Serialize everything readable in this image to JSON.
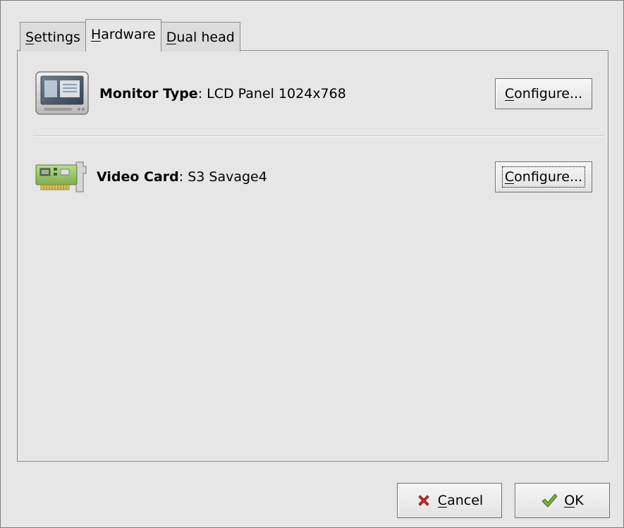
{
  "tabs": [
    {
      "label_mnemonic": "S",
      "label_rest": "ettings",
      "active": false
    },
    {
      "label_mnemonic": "H",
      "label_rest": "ardware",
      "active": true
    },
    {
      "label_mnemonic": "D",
      "label_rest": "ual head",
      "active": false
    }
  ],
  "hardware": {
    "monitor": {
      "icon": "monitor-icon",
      "label": "Monitor Type",
      "value": ": LCD Panel 1024x768",
      "button_mnemonic": "C",
      "button_rest": "onfigure..."
    },
    "video": {
      "icon": "video-card-icon",
      "label": "Video Card",
      "value": ": S3 Savage4",
      "button_mnemonic": "C",
      "button_rest": "onfigure..."
    }
  },
  "actions": {
    "cancel": {
      "icon": "cancel-x-icon",
      "mnemonic": "C",
      "rest": "ancel"
    },
    "ok": {
      "icon": "checkmark-icon",
      "mnemonic": "O",
      "rest": "K"
    }
  },
  "colors": {
    "dialog_bg": "#e6e6e6",
    "cancel_icon": "#cc2a2a",
    "ok_icon": "#7bb33a"
  }
}
